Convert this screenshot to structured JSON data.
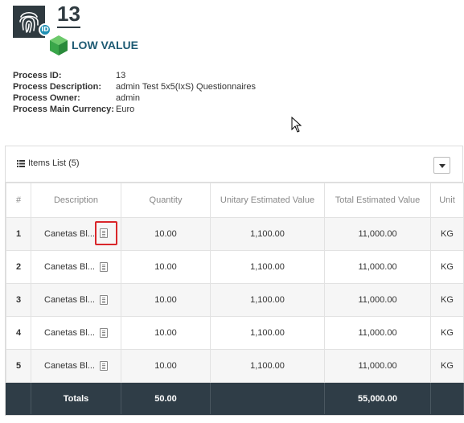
{
  "header": {
    "badge_chip": "ID",
    "process_number": "13",
    "value_label": "LOW VALUE"
  },
  "info": [
    {
      "key": "Process ID:",
      "value": "13"
    },
    {
      "key": "Process Description:",
      "value": "admin Test 5x5(IxS) Questionnaires"
    },
    {
      "key": "Process Owner:",
      "value": "admin"
    },
    {
      "key": "Process Main Currency:",
      "value": "Euro"
    }
  ],
  "items_panel": {
    "title": "Items List (5)",
    "columns": [
      "#",
      "Description",
      "Quantity",
      "Unitary Estimated Value",
      "Total Estimated Value",
      "Unit"
    ],
    "rows": [
      {
        "num": "1",
        "description": "Canetas Bl...",
        "quantity": "10.00",
        "unitary": "1,100.00",
        "total": "11,000.00",
        "unit": "KG"
      },
      {
        "num": "2",
        "description": "Canetas Bl...",
        "quantity": "10.00",
        "unitary": "1,100.00",
        "total": "11,000.00",
        "unit": "KG"
      },
      {
        "num": "3",
        "description": "Canetas Bl...",
        "quantity": "10.00",
        "unitary": "1,100.00",
        "total": "11,000.00",
        "unit": "KG"
      },
      {
        "num": "4",
        "description": "Canetas Bl...",
        "quantity": "10.00",
        "unitary": "1,100.00",
        "total": "11,000.00",
        "unit": "KG"
      },
      {
        "num": "5",
        "description": "Canetas Bl...",
        "quantity": "10.00",
        "unitary": "1,100.00",
        "total": "11,000.00",
        "unit": "KG"
      }
    ],
    "totals": {
      "label": "Totals",
      "quantity": "50.00",
      "total": "55,000.00"
    }
  },
  "colors": {
    "header_dark": "#2f3a40",
    "value_label": "#1d5a73",
    "cube_green": "#3aa64a",
    "totals_bg": "#2f3d47",
    "highlight": "#d9262a"
  }
}
